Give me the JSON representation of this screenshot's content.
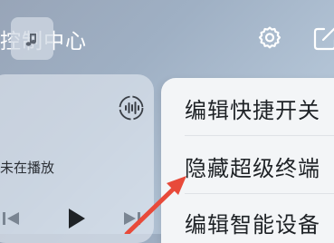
{
  "header": {
    "title": "控制中心",
    "settings_icon": "gear-icon",
    "edit_icon": "edit-icon"
  },
  "media": {
    "status": "未在播放",
    "cover_icon": "music-note-icon",
    "audio_output_icon": "audio-output-icon",
    "controls": [
      "previous-icon",
      "play-icon",
      "next-icon"
    ]
  },
  "menu": {
    "items": [
      {
        "label": "编辑快捷开关"
      },
      {
        "label": "隐藏超级终端"
      },
      {
        "label": "编辑智能设备"
      }
    ]
  },
  "annotation": {
    "arrow_color": "#e84a3a"
  },
  "colors": {
    "background_start": "#98a5b8",
    "background_end": "#c0cfdd",
    "menu_background": "#f3f5f7",
    "text_dark": "#1e2226",
    "text_light": "#ffffff"
  }
}
